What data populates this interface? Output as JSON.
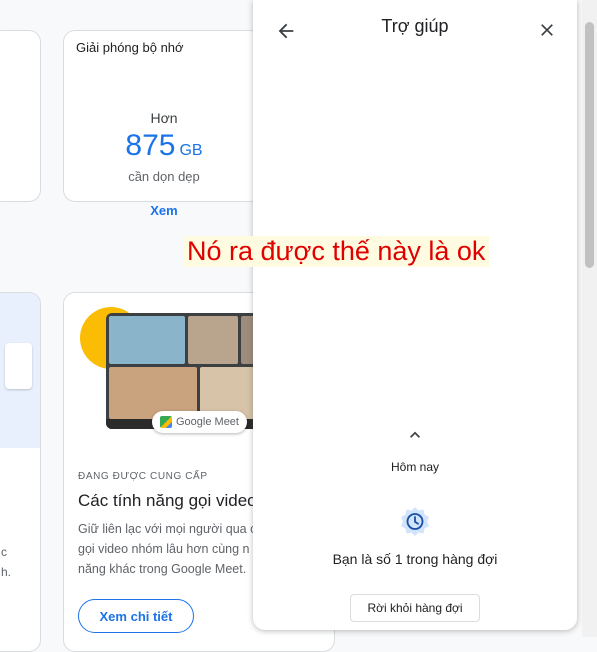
{
  "storage_card": {
    "title": "Giải phóng bộ nhớ",
    "prefix": "Hơn",
    "amount": "875",
    "unit": "GB",
    "subtitle": "cần dọn dẹp",
    "link": "Xem"
  },
  "left_cards": {
    "bottom_text_1": "c",
    "bottom_text_2": "h."
  },
  "meet_card": {
    "badge": "Google Meet",
    "tag": "ĐANG ĐƯỢC CUNG CẤP",
    "heading": "Các tính năng gọi video",
    "desc_lines": [
      "Giữ liên lạc với mọi người qua c",
      "gọi video nhóm lâu hơn cùng n",
      "năng khác trong Google Meet."
    ],
    "button": "Xem chi tiết"
  },
  "help_panel": {
    "title": "Trợ giúp",
    "date_label": "Hôm nay",
    "queue_text": "Bạn là số 1 trong hàng đợi",
    "leave_button": "Rời khỏi hàng đợi"
  },
  "annotation": {
    "text": "Nó ra được thế này là ok",
    "color": "#e00000"
  },
  "colors": {
    "accent": "#1a73e8",
    "meet_yellow": "#fbbc04"
  },
  "icons": {
    "back": "arrow-back-icon",
    "close": "close-icon",
    "expand": "chevron-up-icon",
    "clock": "clock-icon"
  }
}
